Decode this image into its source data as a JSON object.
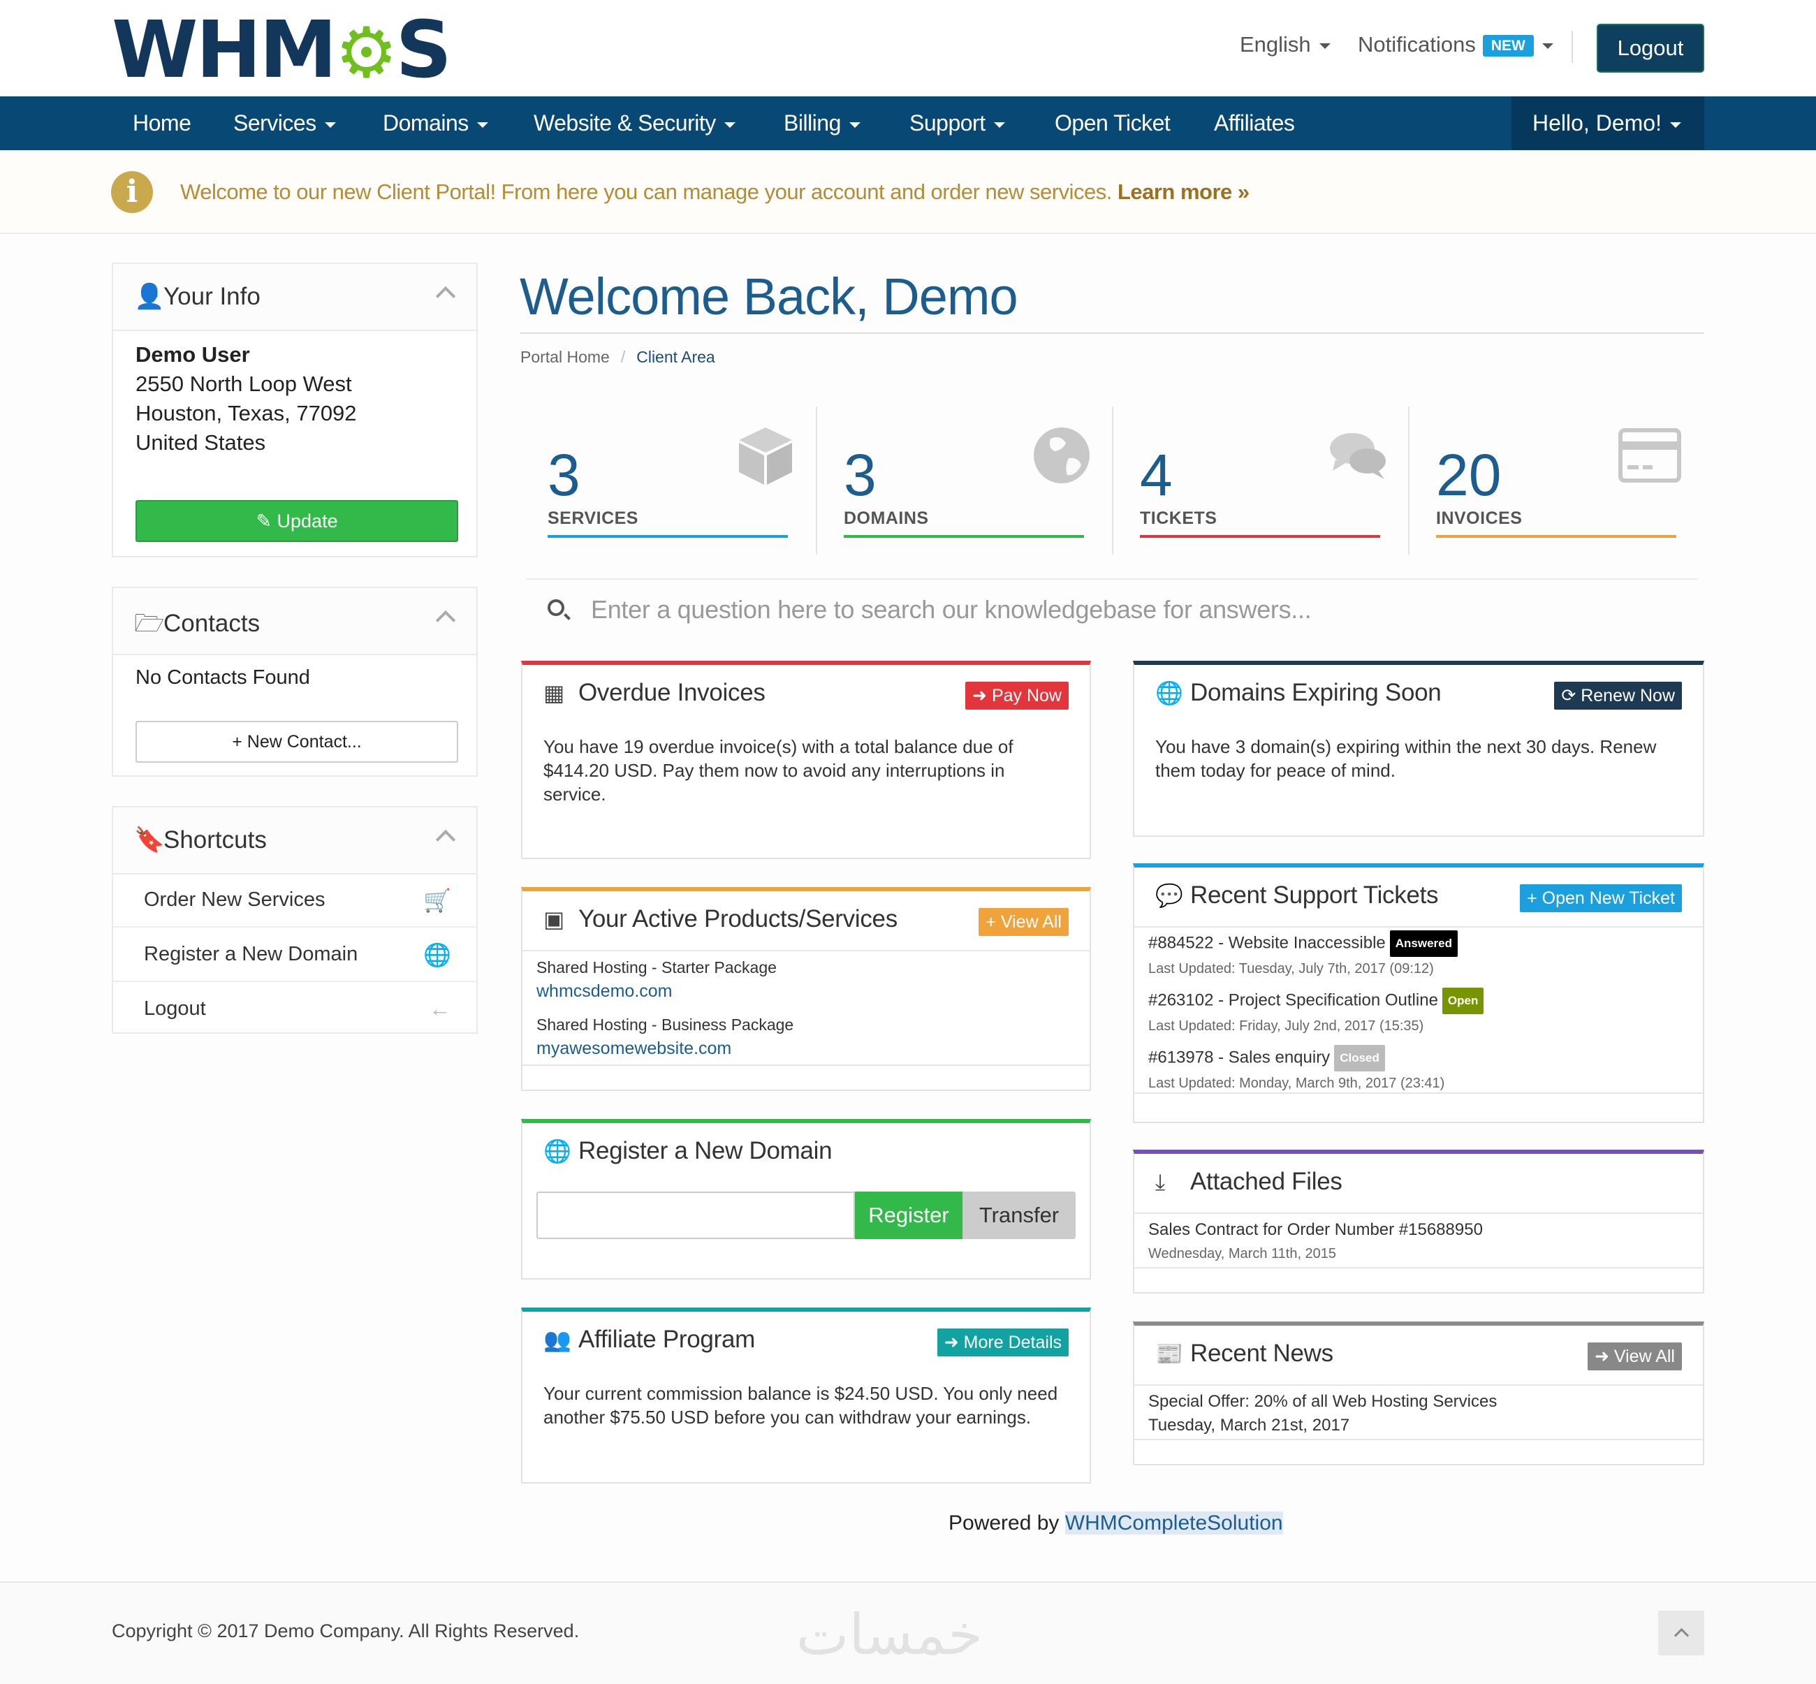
{
  "header": {
    "logo_text": "WHMCS",
    "language": "English",
    "notifications": "Notifications",
    "notifications_badge": "NEW",
    "logout": "Logout"
  },
  "nav": {
    "items": [
      "Home",
      "Services",
      "Domains",
      "Website & Security",
      "Billing",
      "Support",
      "Open Ticket",
      "Affiliates"
    ],
    "user": "Hello, Demo!"
  },
  "alert": {
    "text": "Welcome to our new Client Portal! From here you can manage your account and order new services.",
    "link": "Learn more »"
  },
  "sidebar": {
    "your_info": {
      "title": "Your Info",
      "name": "Demo User",
      "address1": "2550 North Loop West",
      "address2": "Houston, Texas, 77092",
      "country": "United States",
      "update": "Update"
    },
    "contacts": {
      "title": "Contacts",
      "empty": "No Contacts Found",
      "new_contact": "New Contact..."
    },
    "shortcuts": {
      "title": "Shortcuts",
      "items": [
        "Order New Services",
        "Register a New Domain",
        "Logout"
      ]
    }
  },
  "main": {
    "title": "Welcome Back, Demo",
    "breadcrumb": [
      "Portal Home",
      "Client Area"
    ],
    "tiles": [
      {
        "count": "3",
        "label": "SERVICES",
        "color": "#1ba0dd",
        "icon": "cube-icon"
      },
      {
        "count": "3",
        "label": "DOMAINS",
        "color": "#33b94a",
        "icon": "globe-icon"
      },
      {
        "count": "4",
        "label": "TICKETS",
        "color": "#e2363c",
        "icon": "comments-icon"
      },
      {
        "count": "20",
        "label": "INVOICES",
        "color": "#f0a33a",
        "icon": "credit-card-icon"
      }
    ],
    "kb_placeholder": "Enter a question here to search our knowledgebase for answers..."
  },
  "panels": {
    "overdue": {
      "title": "Overdue Invoices",
      "button": "Pay Now",
      "text": "You have 19 overdue invoice(s) with a total balance due of $414.20 USD. Pay them now to avoid any interruptions in service."
    },
    "domains_expiring": {
      "title": "Domains Expiring Soon",
      "button": "Renew Now",
      "text": "You have 3 domain(s) expiring within the next 30 days. Renew them today for peace of mind."
    },
    "products": {
      "title": "Your Active Products/Services",
      "button": "View All",
      "items": [
        {
          "name": "Shared Hosting - Starter Package",
          "domain": "whmcsdemo.com"
        },
        {
          "name": "Shared Hosting - Business Package",
          "domain": "myawesomewebsite.com"
        }
      ]
    },
    "tickets": {
      "title": "Recent Support Tickets",
      "button": "Open New Ticket",
      "items": [
        {
          "subject": "#884522 - Website Inaccessible",
          "status": "Answered",
          "status_color": "#000000",
          "updated": "Last Updated: Tuesday, July 7th, 2017 (09:12)"
        },
        {
          "subject": "#263102 - Project Specification Outline",
          "status": "Open",
          "status_color": "#779500",
          "updated": "Last Updated: Friday, July 2nd, 2017 (15:35)"
        },
        {
          "subject": "#613978 - Sales enquiry",
          "status": "Closed",
          "status_color": "#bbbbbb",
          "updated": "Last Updated: Monday, March 9th, 2017 (23:41)"
        }
      ]
    },
    "register_domain": {
      "title": "Register a New Domain",
      "register": "Register",
      "transfer": "Transfer"
    },
    "files": {
      "title": "Attached Files",
      "name": "Sales Contract for Order Number #15688950",
      "date": "Wednesday, March 11th, 2015"
    },
    "affiliate": {
      "title": "Affiliate Program",
      "button": "More Details",
      "text": "Your current commission balance is $24.50 USD. You only need another $75.50 USD before you can withdraw your earnings."
    },
    "news": {
      "title": "Recent News",
      "button": "View All",
      "headline": "Special Offer: 20% of all Web Hosting Services",
      "date": "Tuesday, March 21st, 2017"
    }
  },
  "powered": {
    "prefix": "Powered by",
    "link": "WHMCompleteSolution"
  },
  "footer": {
    "copyright": "Copyright © 2017 Demo Company. All Rights Reserved.",
    "watermark": "خمسات"
  }
}
